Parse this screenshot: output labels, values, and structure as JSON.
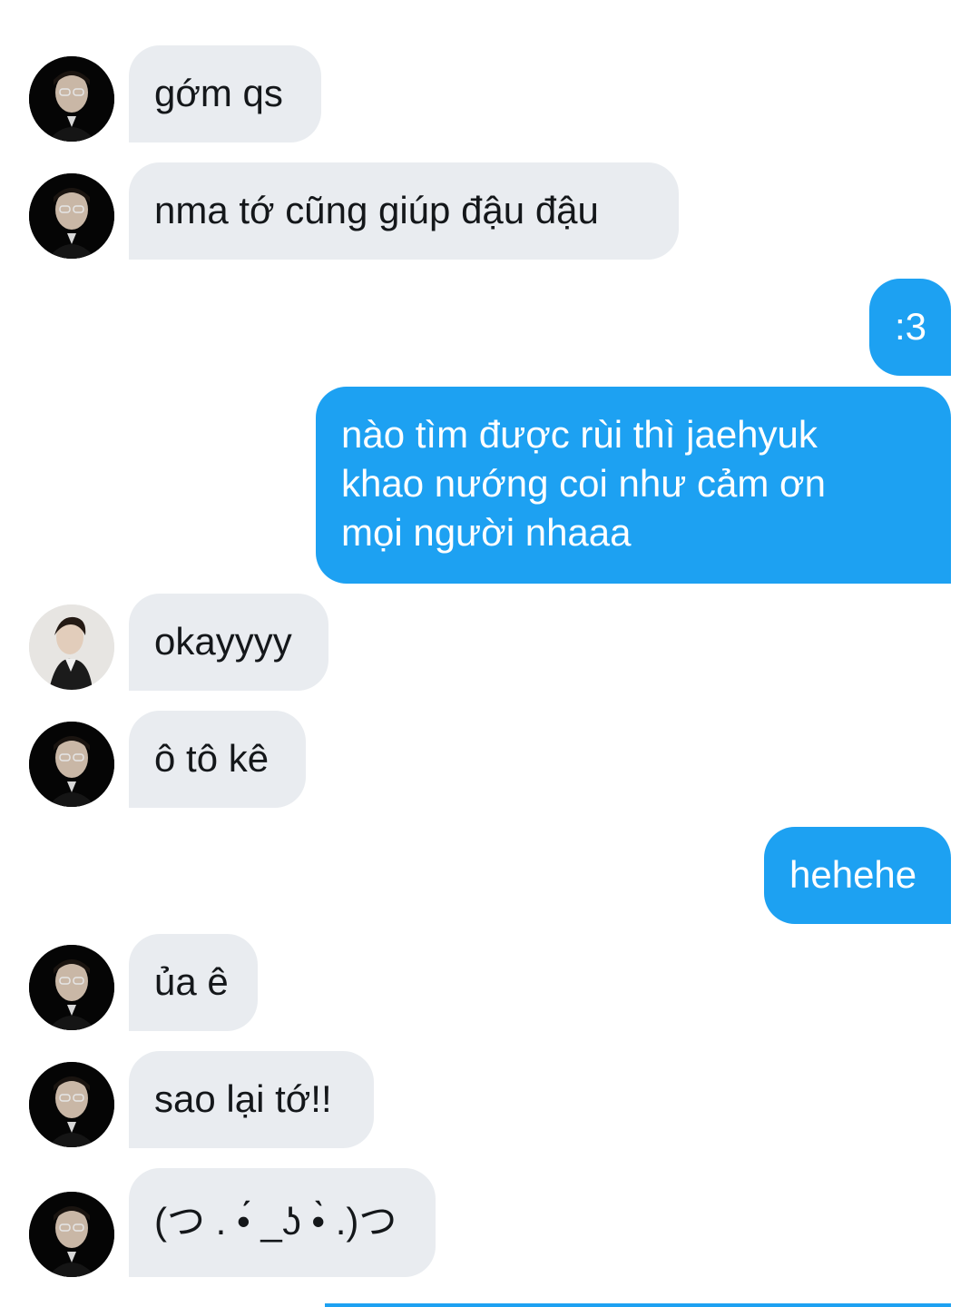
{
  "conversation": {
    "messages": [
      {
        "side": "in",
        "avatar": "dark-portrait",
        "text": "gớm qs"
      },
      {
        "side": "in",
        "avatar": "dark-portrait",
        "text": "nma tớ cũng giúp đậu đậu"
      },
      {
        "side": "out",
        "text": ":3"
      },
      {
        "side": "out",
        "text": "nào tìm được rùi thì jaehyuk\nkhao nướng coi như cảm ơn\nmọi người nhaaa"
      },
      {
        "side": "in",
        "avatar": "light-portrait",
        "text": "okayyyy"
      },
      {
        "side": "in",
        "avatar": "dark-portrait",
        "text": "ô tô kê"
      },
      {
        "side": "out",
        "text": "hehehe"
      },
      {
        "side": "in",
        "avatar": "dark-portrait",
        "text": "ủa ê"
      },
      {
        "side": "in",
        "avatar": "dark-portrait",
        "text": "sao lại tớ!!"
      },
      {
        "side": "in",
        "avatar": "dark-portrait",
        "text": "(つ . •́ _ʖ •̀ .)つ"
      }
    ]
  },
  "colors": {
    "incoming_bubble": "#e9ecf0",
    "outgoing_bubble": "#1da1f2",
    "incoming_text": "#14171a",
    "outgoing_text": "#ffffff"
  }
}
